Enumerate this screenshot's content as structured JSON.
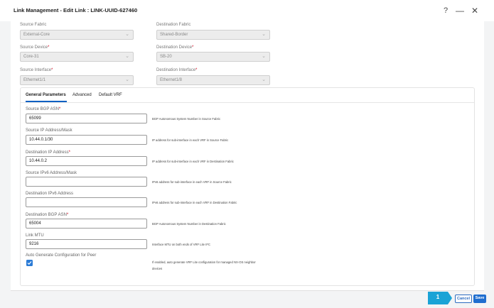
{
  "header": {
    "title": "Link Management - Edit Link : LINK-UUID-627460",
    "help_glyph": "?",
    "minimize_glyph": "—",
    "close_glyph": "✕"
  },
  "link": {
    "source_fabric": {
      "label": "Source Fabric",
      "value": "External-Core"
    },
    "destination_fabric": {
      "label": "Destination Fabric",
      "value": "Shared-Border"
    },
    "source_device": {
      "label": "Source Device",
      "value": "Core-31"
    },
    "destination_device": {
      "label": "Destination Device",
      "value": "SB-20"
    },
    "source_interface": {
      "label": "Source Interface",
      "value": "Ethernet1/1"
    },
    "destination_interface": {
      "label": "Destination Interface",
      "value": "Ethernet1/8"
    }
  },
  "tabs": [
    {
      "label": "General Parameters",
      "active": true
    },
    {
      "label": "Advanced",
      "active": false
    },
    {
      "label": "Default VRF",
      "active": false
    }
  ],
  "general": {
    "source_bgp_asn": {
      "label": "Source BGP ASN",
      "value": "65099",
      "help": "BGP Autonomous System Number in Source Fabric"
    },
    "source_ip": {
      "label": "Source IP Address/Mask",
      "value": "10.44.0.1/30",
      "help": "IP address for sub-interface in each VRF in Source Fabric"
    },
    "destination_ip": {
      "label": "Destination IP Address",
      "value": "10.44.0.2",
      "help": "IP address for sub-interface in each VRF in Destination Fabric"
    },
    "source_ipv6": {
      "label": "Source IPv6 Address/Mask",
      "value": "",
      "help": "IPv6 address for sub-interface in each VRF in Source Fabric"
    },
    "destination_ipv6": {
      "label": "Destination IPv6 Address",
      "value": "",
      "help": "IPv6 address for sub-interface in each VRF in Destination Fabric"
    },
    "destination_bgp_asn": {
      "label": "Destination BGP ASN",
      "value": "65004",
      "help": "BGP Autonomous System Number in Destination Fabric"
    },
    "link_mtu": {
      "label": "Link MTU",
      "value": "9216",
      "help": "Interface MTU on both ends of VRF Lite IFC"
    },
    "auto_generate": {
      "label": "Auto Generate Configuration for Peer",
      "checked": true,
      "help_line1": "If enabled, auto generate VRF Lite configuration for managed NX-OS neighbor",
      "help_line2": "devices"
    }
  },
  "footer": {
    "step_number": "1",
    "cancel_label": "Cancel",
    "save_label": "Save"
  },
  "colors": {
    "accent": "#1f6ecf",
    "required": "#d0021b",
    "step_badge": "#1aa3d6"
  }
}
